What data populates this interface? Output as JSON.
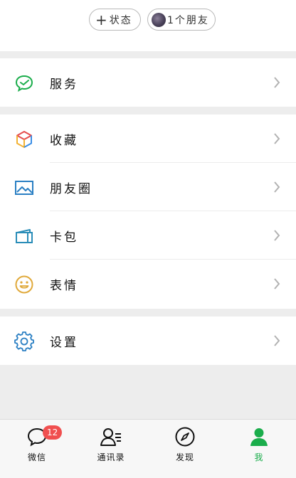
{
  "header": {
    "status_label": "状态",
    "friends_label": "1个朋友"
  },
  "menu": {
    "service": "服务",
    "favorites": "收藏",
    "moments": "朋友圈",
    "cards": "卡包",
    "stickers": "表情",
    "settings": "设置"
  },
  "tabbar": {
    "chats": "微信",
    "chats_badge": "12",
    "contacts": "通讯录",
    "discover": "发现",
    "me": "我",
    "active_tab": "me"
  },
  "colors": {
    "accent_green": "#1aad4b",
    "badge_red": "#f04f4f",
    "icon_blue": "#2a7fc3",
    "icon_orange": "#e0a93a"
  }
}
